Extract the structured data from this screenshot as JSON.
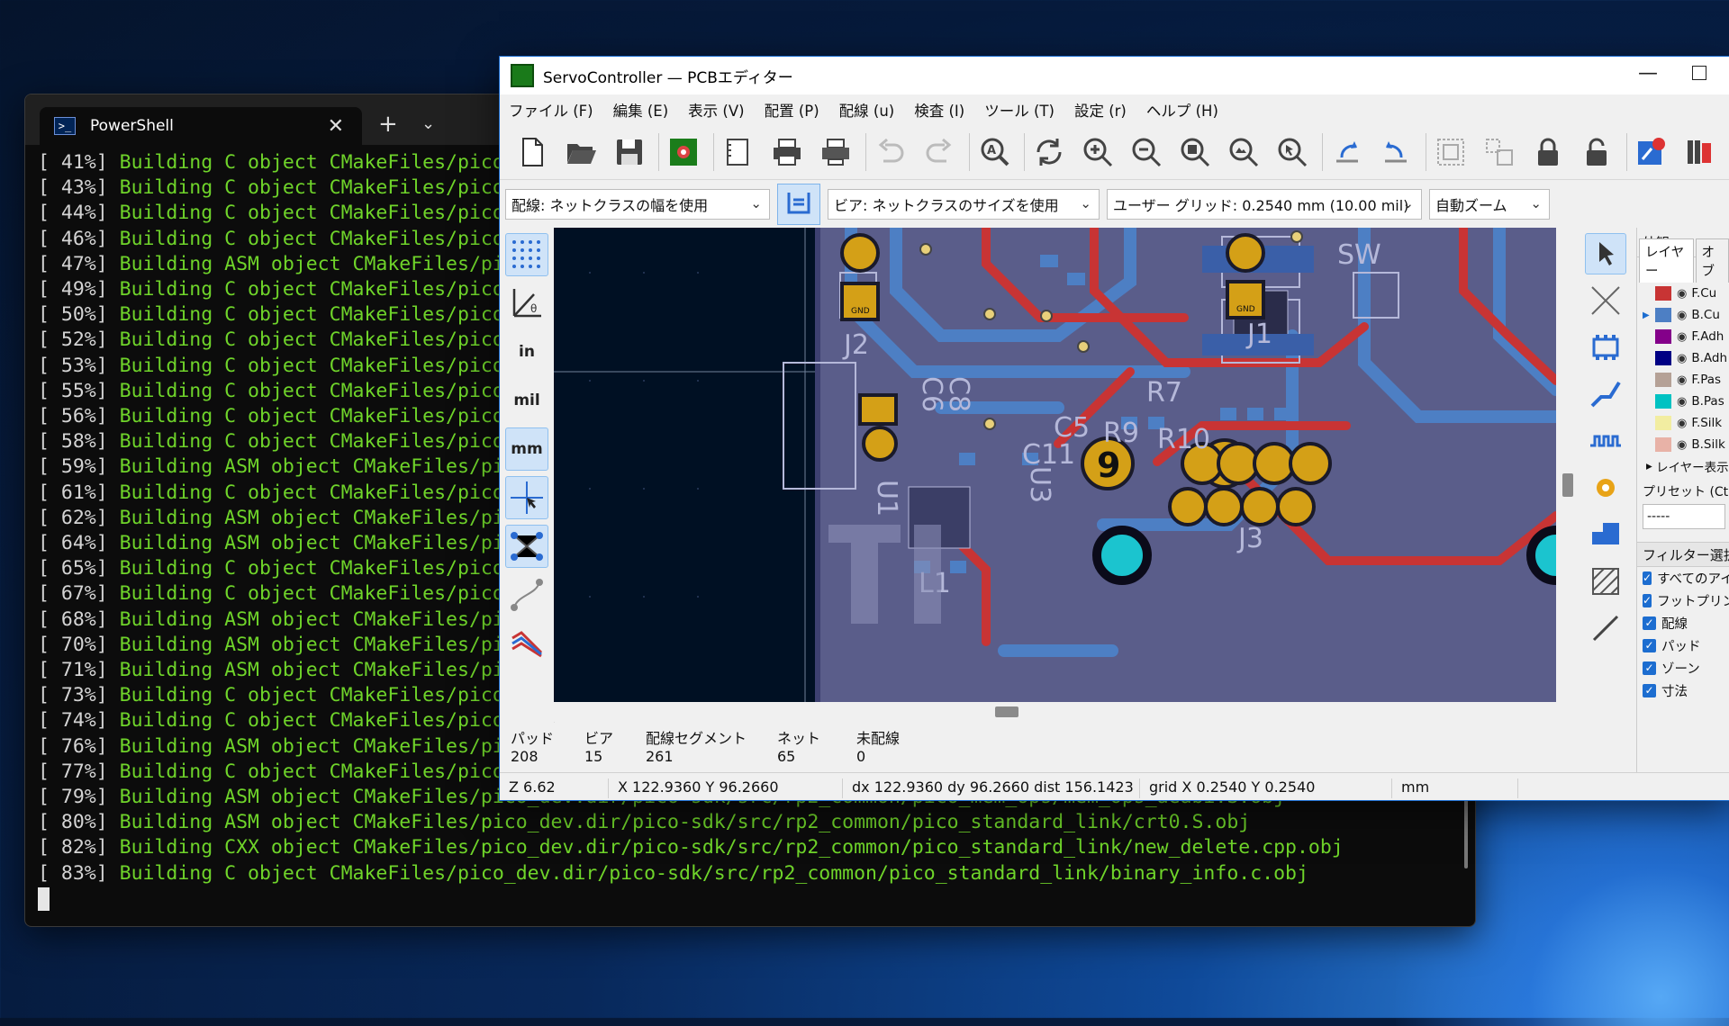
{
  "terminal": {
    "tab_title": "PowerShell",
    "new_tab": "+",
    "lines": [
      {
        "pct": "[ 41%]",
        "msg": "Building C object CMakeFiles/pico"
      },
      {
        "pct": "[ 43%]",
        "msg": "Building C object CMakeFiles/pico"
      },
      {
        "pct": "[ 44%]",
        "msg": "Building C object CMakeFiles/pico"
      },
      {
        "pct": "[ 46%]",
        "msg": "Building C object CMakeFiles/pico"
      },
      {
        "pct": "[ 47%]",
        "msg": "Building ASM object CMakeFiles/pi"
      },
      {
        "pct": "[ 49%]",
        "msg": "Building C object CMakeFiles/pico"
      },
      {
        "pct": "[ 50%]",
        "msg": "Building C object CMakeFiles/pico"
      },
      {
        "pct": "[ 52%]",
        "msg": "Building C object CMakeFiles/pico"
      },
      {
        "pct": "[ 53%]",
        "msg": "Building C object CMakeFiles/pico"
      },
      {
        "pct": "[ 55%]",
        "msg": "Building C object CMakeFiles/pico"
      },
      {
        "pct": "[ 56%]",
        "msg": "Building C object CMakeFiles/pico"
      },
      {
        "pct": "[ 58%]",
        "msg": "Building C object CMakeFiles/pico"
      },
      {
        "pct": "[ 59%]",
        "msg": "Building ASM object CMakeFiles/pi"
      },
      {
        "pct": "[ 61%]",
        "msg": "Building C object CMakeFiles/pico"
      },
      {
        "pct": "[ 62%]",
        "msg": "Building ASM object CMakeFiles/pi"
      },
      {
        "pct": "[ 64%]",
        "msg": "Building ASM object CMakeFiles/pi"
      },
      {
        "pct": "[ 65%]",
        "msg": "Building C object CMakeFiles/pico"
      },
      {
        "pct": "[ 67%]",
        "msg": "Building C object CMakeFiles/pico"
      },
      {
        "pct": "[ 68%]",
        "msg": "Building ASM object CMakeFiles/pi"
      },
      {
        "pct": "[ 70%]",
        "msg": "Building ASM object CMakeFiles/pi"
      },
      {
        "pct": "[ 71%]",
        "msg": "Building ASM object CMakeFiles/pi"
      },
      {
        "pct": "[ 73%]",
        "msg": "Building C object CMakeFiles/pico"
      },
      {
        "pct": "[ 74%]",
        "msg": "Building C object CMakeFiles/pico"
      },
      {
        "pct": "[ 76%]",
        "msg": "Building ASM object CMakeFiles/pi"
      },
      {
        "pct": "[ 77%]",
        "msg": "Building C object CMakeFiles/pico"
      },
      {
        "pct": "[ 79%]",
        "msg": "Building ASM object CMakeFiles/pico_dev.dir/pico-sdk/src/rp2_common/pico_mem_ops/mem_ops_aeabi.S.obj"
      },
      {
        "pct": "[ 80%]",
        "msg": "Building ASM object CMakeFiles/pico_dev.dir/pico-sdk/src/rp2_common/pico_standard_link/crt0.S.obj"
      },
      {
        "pct": "[ 82%]",
        "msg": "Building CXX object CMakeFiles/pico_dev.dir/pico-sdk/src/rp2_common/pico_standard_link/new_delete.cpp.obj"
      },
      {
        "pct": "[ 83%]",
        "msg": "Building C object CMakeFiles/pico_dev.dir/pico-sdk/src/rp2_common/pico_standard_link/binary_info.c.obj"
      }
    ]
  },
  "kicad": {
    "title": "ServoController — PCBエディター",
    "menu": [
      "ファイル (F)",
      "編集 (E)",
      "表示 (V)",
      "配置 (P)",
      "配線 (u)",
      "検査 (I)",
      "ツール (T)",
      "設定 (r)",
      "ヘルプ (H)"
    ],
    "options": {
      "track_width": "配線: ネットクラスの幅を使用",
      "via_size": "ビア: ネットクラスのサイズを使用",
      "grid": "ユーザー グリッド: 0.2540 mm (10.00 mil)",
      "zoom": "自動ズーム"
    },
    "left_tools": {
      "in": "in",
      "mil": "mil",
      "mm": "mm"
    },
    "appearance": {
      "header": "外観",
      "tab_layers": "レイヤー",
      "tab_objects": "オブ",
      "layers": [
        {
          "name": "F.Cu",
          "color": "#c83434"
        },
        {
          "name": "B.Cu",
          "color": "#4d7fc4"
        },
        {
          "name": "F.Adh",
          "color": "#84008a"
        },
        {
          "name": "B.Adh",
          "color": "#000084"
        },
        {
          "name": "F.Pas",
          "color": "#b5a196"
        },
        {
          "name": "B.Pas",
          "color": "#00c2c2"
        },
        {
          "name": "F.Silk",
          "color": "#f2eda1"
        },
        {
          "name": "B.Silk",
          "color": "#e8b2a7"
        }
      ],
      "layer_display": "レイヤー表示オ",
      "preset_label": "プリセット (Ctrl+",
      "preset_value": "-----",
      "filter_title": "フィルター選択",
      "filters": [
        "すべてのアイ",
        "フットプリント",
        "配線",
        "パッド",
        "ゾーン",
        "寸法"
      ]
    },
    "stats": {
      "pads_label": "パッド",
      "pads": "208",
      "vias_label": "ビア",
      "vias": "15",
      "segments_label": "配線セグメント",
      "segments": "261",
      "nets_label": "ネット",
      "nets": "65",
      "unrouted_label": "未配線",
      "unrouted": "0"
    },
    "status": {
      "zoom": "Z 6.62",
      "xy": "X 122.9360  Y 96.2660",
      "dxy": "dx 122.9360  dy 96.2660  dist 156.1423",
      "grid": "grid X 0.2540  Y 0.2540",
      "units": "mm"
    },
    "pcb_labels": {
      "j1": "J1",
      "j2": "J2",
      "j3": "J3",
      "u1": "U1",
      "u3": "U3",
      "l1": "L1",
      "c5": "C5",
      "c6": "C6",
      "c8": "C8",
      "c11": "C11",
      "r7": "R7",
      "r9": "R9",
      "r10": "R10",
      "big9": "9",
      "gnd": "GND",
      "sw": "SW"
    },
    "colors": {
      "canvas_bg": "#001023",
      "board": "#5a5d8a",
      "fcu": "#c83434",
      "bcu": "#4d7fc4",
      "pad_gold": "#d4a017",
      "silk": "#b5b8d9"
    }
  }
}
